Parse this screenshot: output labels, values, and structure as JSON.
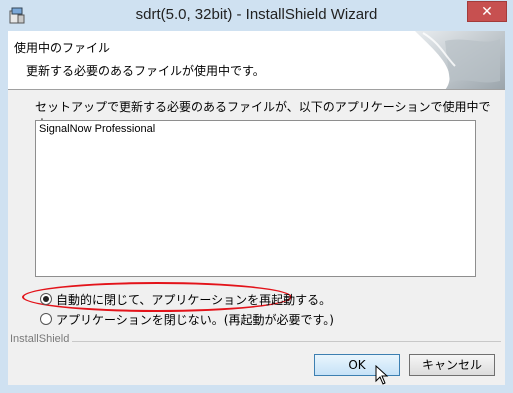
{
  "window": {
    "title": "sdrt(5.0, 32bit) - InstallShield Wizard",
    "close_label": "✕"
  },
  "banner": {
    "title": "使用中のファイル",
    "subtitle": "更新する必要のあるファイルが使用中です。"
  },
  "instruction": "セットアップで更新する必要のあるファイルが、以下のアプリケーションで使用中です。",
  "list": {
    "items": [
      "SignalNow Professional"
    ]
  },
  "options": {
    "auto_close": {
      "label": "自動的に閉じて、アプリケーションを再起動する。",
      "checked": true
    },
    "no_close": {
      "label": "アプリケーションを閉じない。(再起動が必要です。)",
      "checked": false
    }
  },
  "footer": {
    "brand": "InstallShield"
  },
  "buttons": {
    "ok": "OK",
    "cancel": "キャンセル"
  },
  "colors": {
    "highlight": "#e3131a",
    "titlebar": "#cfe1f1",
    "close": "#c75050"
  }
}
